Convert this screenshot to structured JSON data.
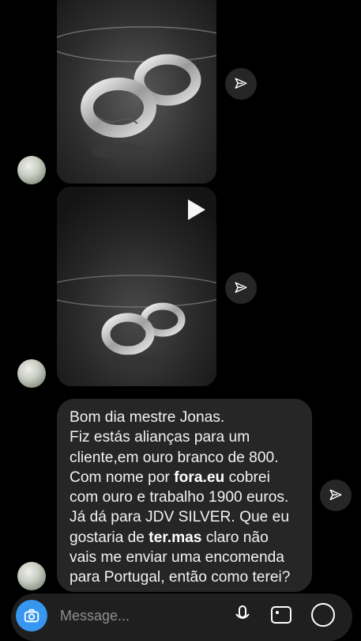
{
  "chat": {
    "messages": [
      {
        "type": "photo",
        "content": "two silver engraved wedding rings on a black mirrored surface",
        "sender": "contact"
      },
      {
        "type": "video",
        "content": "two silver engraved wedding rings on a black mirrored surface",
        "sender": "contact"
      },
      {
        "type": "text",
        "sender": "contact",
        "lines": [
          "Bom dia mestre Jonas.",
          "Fiz estás alianças para um",
          "cliente,em ouro branco de 800.",
          "Com nome por",
          "fora.eu",
          "cobrei",
          "com ouro e trabalho 1900 euros.",
          "Já dá para JDV SILVER. Que eu",
          "gostaria de",
          "ter.mas",
          "claro não",
          "vais me enviar uma encomenda",
          "para Portugal, então como terei?"
        ]
      }
    ]
  },
  "composer": {
    "placeholder": "Message...",
    "icons": [
      "camera-icon",
      "microphone-icon",
      "gallery-icon",
      "add-icon"
    ]
  },
  "icons": {
    "share": "paper-plane-icon",
    "play": "play-icon"
  },
  "colors": {
    "background": "#000000",
    "bubble": "#262626",
    "accent": "#3797f0",
    "text": "#f2f2f2"
  }
}
